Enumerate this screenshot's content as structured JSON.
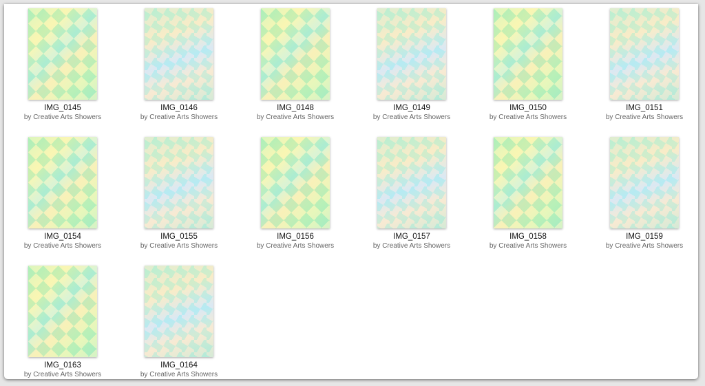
{
  "items": [
    {
      "name": "IMG_0145",
      "by": "by Creative Arts Showers"
    },
    {
      "name": "IMG_0146",
      "by": "by Creative Arts Showers"
    },
    {
      "name": "IMG_0148",
      "by": "by Creative Arts Showers"
    },
    {
      "name": "IMG_0149",
      "by": "by Creative Arts Showers"
    },
    {
      "name": "IMG_0150",
      "by": "by Creative Arts Showers"
    },
    {
      "name": "IMG_0151",
      "by": "by Creative Arts Showers"
    },
    {
      "name": "IMG_0154",
      "by": "by Creative Arts Showers"
    },
    {
      "name": "IMG_0155",
      "by": "by Creative Arts Showers"
    },
    {
      "name": "IMG_0156",
      "by": "by Creative Arts Showers"
    },
    {
      "name": "IMG_0157",
      "by": "by Creative Arts Showers"
    },
    {
      "name": "IMG_0158",
      "by": "by Creative Arts Showers"
    },
    {
      "name": "IMG_0159",
      "by": "by Creative Arts Showers"
    },
    {
      "name": "IMG_0163",
      "by": "by Creative Arts Showers"
    },
    {
      "name": "IMG_0164",
      "by": "by Creative Arts Showers"
    }
  ]
}
